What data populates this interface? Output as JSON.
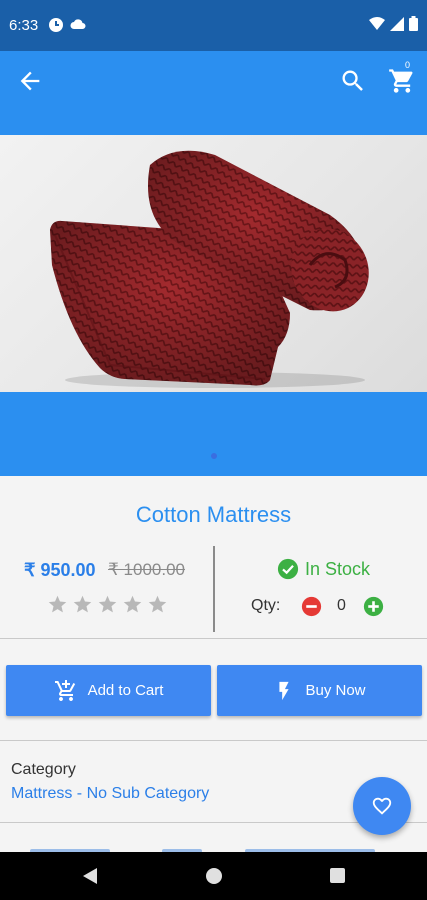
{
  "status_bar": {
    "time": "6:33"
  },
  "app_bar": {
    "cart_count": "0"
  },
  "product": {
    "title": "Cotton Mattress",
    "price": "₹ 950.00",
    "old_price": "₹ 1000.00",
    "rating": 0,
    "rating_max": 5,
    "stock_status": "In Stock",
    "qty_label": "Qty:",
    "qty_value": "0"
  },
  "actions": {
    "add_to_cart": "Add to Cart",
    "buy_now": "Buy Now"
  },
  "category": {
    "label": "Category",
    "value": "Mattress - No Sub Category"
  },
  "colors": {
    "primary": "#2b8ff0",
    "status_bar": "#1a5fa8",
    "in_stock": "#3cb043",
    "minus": "#e53935",
    "plus": "#3cb043",
    "mattress": "#a32a2e"
  },
  "icons": {
    "back": "arrow-left-icon",
    "search": "search-icon",
    "cart": "cart-icon",
    "stock": "check-circle-icon",
    "add_cart": "cart-plus-icon",
    "buy": "flash-icon",
    "favorite": "heart-icon"
  }
}
